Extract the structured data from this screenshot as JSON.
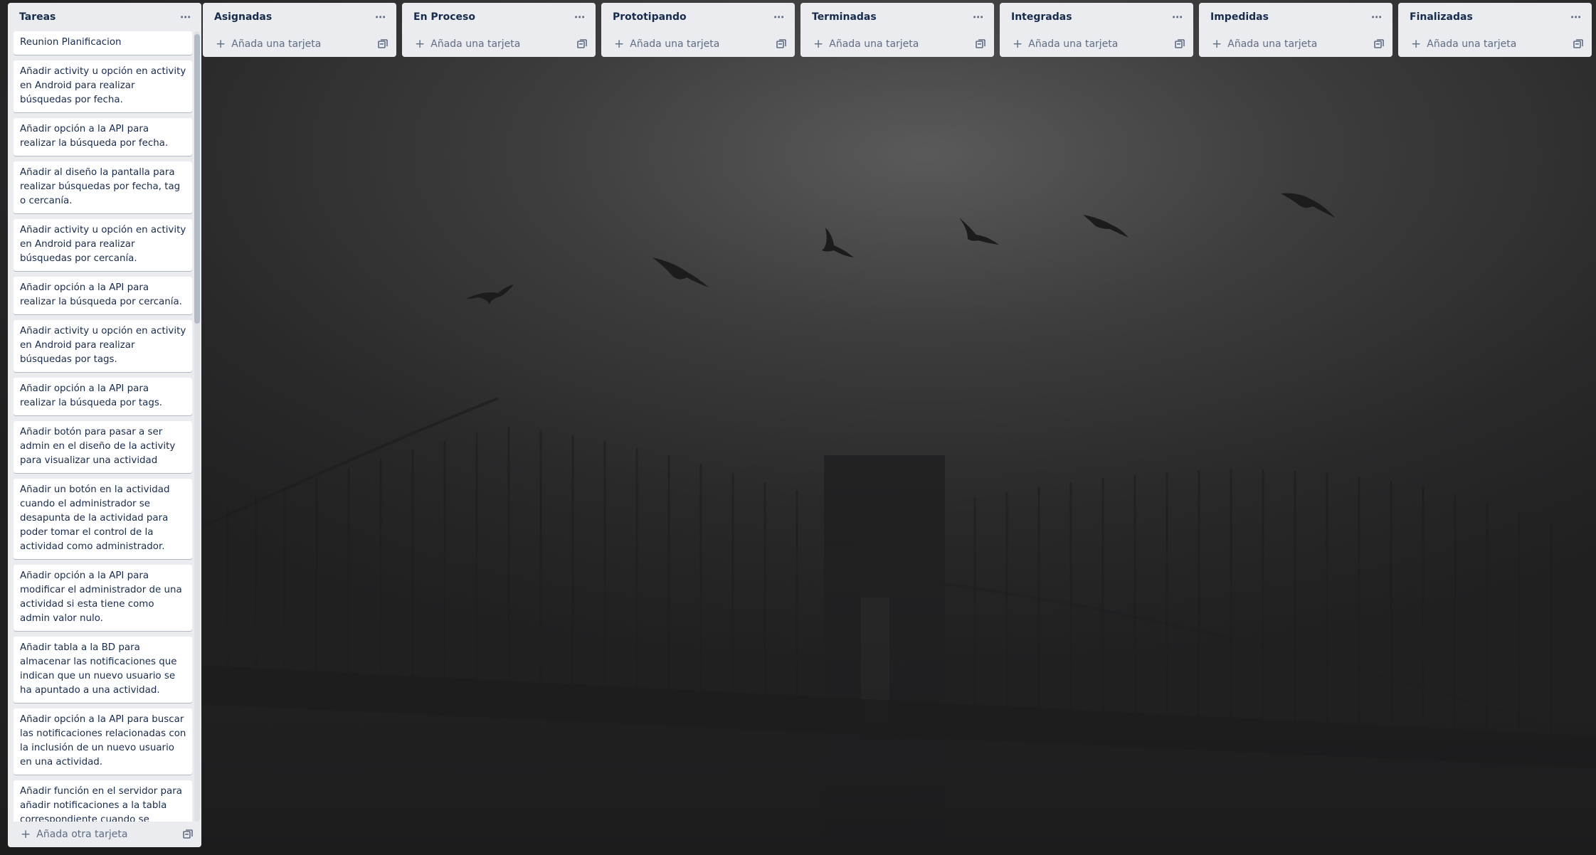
{
  "lists": [
    {
      "title": "Tareas",
      "composer_label": "Añada otra tarjeta",
      "cards": [
        "Reunion Planificacion",
        "Añadir activity u opción en activity en Android para realizar búsquedas por fecha.",
        "Añadir opción a la API para realizar la búsqueda por fecha.",
        "Añadir al diseño la pantalla para realizar búsquedas por fecha, tag o cercanía.",
        "Añadir activity u opción en activity en Android para realizar búsquedas por cercanía.",
        "Añadir opción a la API para realizar la búsqueda por cercanía.",
        "Añadir activity u opción en activity en Android para realizar búsquedas por tags.",
        "Añadir opción a la API para realizar la búsqueda por tags.",
        "Añadir botón para pasar a ser admin en el diseño de la activity para visualizar una actividad",
        "Añadir un botón en la actividad cuando el administrador se desapunta de la actividad para poder tomar el control de la actividad como administrador.",
        "Añadir opción a la API para modificar el administrador de una actividad si esta tiene como admin valor nulo.",
        "Añadir tabla a la BD para almacenar las notificaciones que indican que un nuevo usuario se ha apuntado a una actividad.",
        "Añadir opción a la API para buscar las notificaciones relacionadas con la inclusión de un nuevo usuario en una actividad.",
        "Añadir función en el servidor para añadir notificaciones a la tabla correspondiente cuando se produce el evento de inclusión de usuario en una actividad."
      ]
    },
    {
      "title": "Asignadas",
      "composer_label": "Añada una tarjeta",
      "cards": []
    },
    {
      "title": "En Proceso",
      "composer_label": "Añada una tarjeta",
      "cards": []
    },
    {
      "title": "Prototipando",
      "composer_label": "Añada una tarjeta",
      "cards": []
    },
    {
      "title": "Terminadas",
      "composer_label": "Añada una tarjeta",
      "cards": []
    },
    {
      "title": "Integradas",
      "composer_label": "Añada una tarjeta",
      "cards": []
    },
    {
      "title": "Impedidas",
      "composer_label": "Añada una tarjeta",
      "cards": []
    },
    {
      "title": "Finalizadas",
      "composer_label": "Añada una tarjeta",
      "cards": []
    }
  ],
  "icons": {
    "list_menu": "more-horizontal-icon",
    "add": "plus-icon",
    "template": "card-template-icon"
  },
  "colors": {
    "list_bg": "#ebecf0",
    "card_bg": "#ffffff",
    "text": "#172b4d",
    "muted": "#5e6c84"
  }
}
